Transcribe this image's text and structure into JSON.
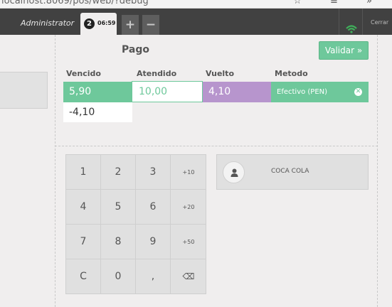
{
  "browser": {
    "url_text": "localhost:8069/pos/web/?debug"
  },
  "topbar": {
    "user": "Administrator",
    "order_number": "2",
    "order_time": "06:59",
    "add_label": "+",
    "remove_label": "−",
    "close_label": "Cerrar"
  },
  "payment": {
    "title": "Pago",
    "validate_label": "Validar »",
    "headers": {
      "due": "Vencido",
      "tendered": "Atendido",
      "change": "Vuelto",
      "method": "Metodo"
    },
    "line": {
      "due": "5,90",
      "tendered": "10,00",
      "change": "4,10",
      "method": "Efectivo (PEN)"
    },
    "remaining": "-4,10"
  },
  "numpad": {
    "keys": [
      "1",
      "2",
      "3",
      "+10",
      "4",
      "5",
      "6",
      "+20",
      "7",
      "8",
      "9",
      "+50",
      "C",
      "0",
      ",",
      "⌫"
    ]
  },
  "product": {
    "name": "COCA COLA"
  },
  "colors": {
    "accent": "#6ec89b",
    "change": "#b795cd",
    "topbar": "#414141"
  }
}
